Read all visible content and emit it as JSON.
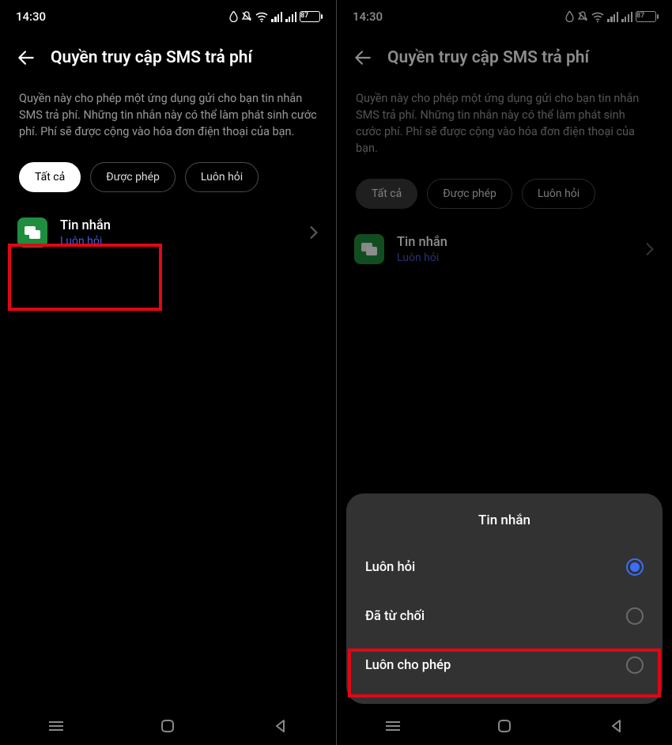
{
  "status": {
    "time": "14:30",
    "battery": "87"
  },
  "header": {
    "title": "Quyền truy cập SMS trả phí"
  },
  "description": "Quyền này cho phép một ứng dụng gửi cho bạn tin nhắn SMS trả phí. Những tin nhắn này có thể làm phát sinh cước phí. Phí sẽ được cộng vào hóa đơn điện thoại của bạn.",
  "chips": {
    "all": "Tất cả",
    "allowed": "Được phép",
    "ask": "Luôn hỏi"
  },
  "app": {
    "name": "Tin nhắn",
    "sub": "Luôn hỏi"
  },
  "sheet": {
    "title": "Tin nhắn",
    "opt_ask": "Luôn hỏi",
    "opt_deny": "Đã từ chối",
    "opt_allow": "Luôn cho phép"
  }
}
